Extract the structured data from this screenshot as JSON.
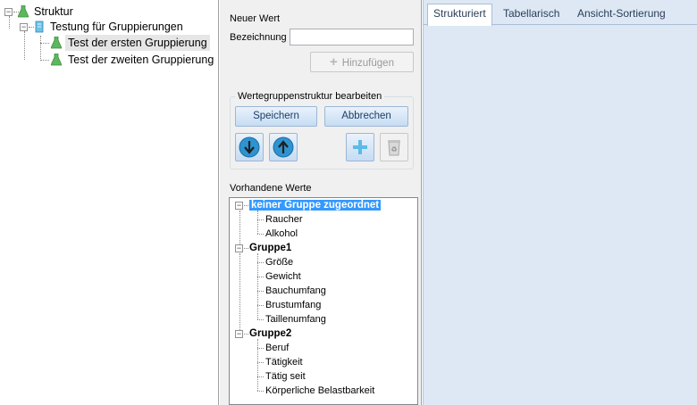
{
  "left_tree": {
    "root": {
      "label": "Struktur"
    },
    "study": {
      "label": "Testung für Gruppierungen"
    },
    "children": [
      {
        "label": "Test der ersten Gruppierung"
      },
      {
        "label": "Test der zweiten Gruppierung"
      }
    ]
  },
  "editor": {
    "new_value_label": "Neuer Wert",
    "name_label": "Bezeichnung",
    "name_value": "",
    "add_button": "Hinzufügen",
    "group_box_title": "Wertegruppenstruktur bearbeiten",
    "save_button": "Speichern",
    "cancel_button": "Abbrechen",
    "existing_values_label": "Vorhandene Werte"
  },
  "values_tree": {
    "groups": [
      {
        "label": "keiner Gruppe zugeordnet",
        "items": [
          "Raucher",
          "Alkohol"
        ]
      },
      {
        "label": "Gruppe1",
        "items": [
          "Größe",
          "Gewicht",
          "Bauchumfang",
          "Brustumfang",
          "Taillenumfang"
        ]
      },
      {
        "label": "Gruppe2",
        "items": [
          "Beruf",
          "Tätigkeit",
          "Tätig seit",
          "Körperliche Belastbarkeit"
        ]
      }
    ]
  },
  "tabs": [
    {
      "label": "Strukturiert"
    },
    {
      "label": "Tabellarisch"
    },
    {
      "label": "Ansicht-Sortierung"
    }
  ],
  "colors": {
    "selection": "#3399ff",
    "tab_background": "#dde8f4",
    "flask_green": "#5cb85c"
  },
  "icons": {
    "flask": "flask-icon",
    "document": "document-icon",
    "add": "plus-icon",
    "down": "arrow-down-icon",
    "up": "arrow-up-icon",
    "delete": "recycle-bin-icon"
  }
}
